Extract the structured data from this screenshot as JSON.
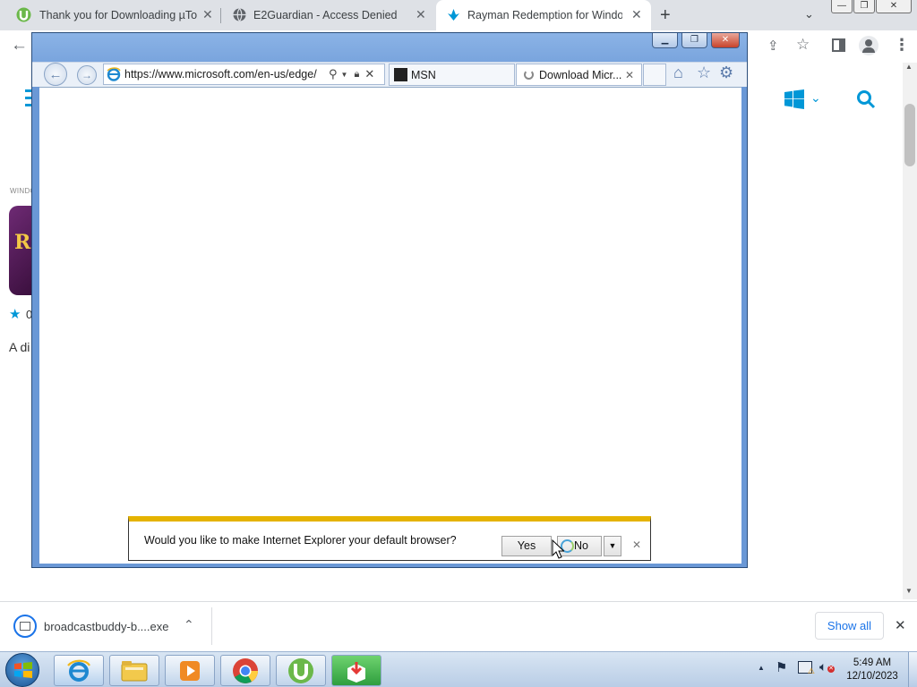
{
  "chrome": {
    "tabs": [
      {
        "title": "Thank you for Downloading µTorrent",
        "favicon": "utorrent-icon"
      },
      {
        "title": "E2Guardian - Access Denied",
        "favicon": "globe-icon"
      },
      {
        "title": "Rayman Redemption for Windows",
        "favicon": "softonic-icon"
      }
    ],
    "new_tab": "+",
    "close": "✕"
  },
  "background_page": {
    "category_label": "WINDO",
    "rating_fragment": "0",
    "desc_fragment": "A di"
  },
  "ie": {
    "url": "https://www.microsoft.com/en-us/edge/",
    "tabs": [
      {
        "title": "MSN"
      },
      {
        "title": "Download Micr..."
      }
    ],
    "notification": {
      "message": "Would you like to make Internet Explorer your default browser?",
      "yes": "Yes",
      "no": "No"
    }
  },
  "downloads": {
    "file": "broadcastbuddy-b....exe",
    "show_all": "Show all"
  },
  "taskbar": {
    "time": "5:49 AM",
    "date": "12/10/2023"
  },
  "colors": {
    "accent": "#0097d7",
    "ie_frame": "#6a98d6",
    "notif_bar": "#e5b300"
  }
}
